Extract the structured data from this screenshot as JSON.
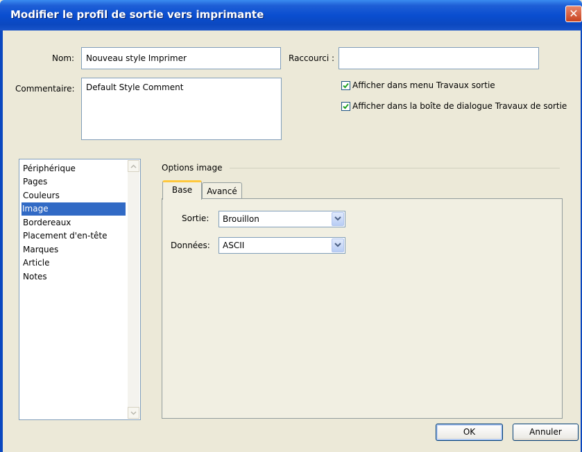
{
  "window": {
    "title": "Modifier le profil de sortie vers imprimante",
    "close_symbol": "✕"
  },
  "form": {
    "nom_label": "Nom:",
    "nom_value": "Nouveau style Imprimer",
    "raccourci_label": "Raccourci :",
    "raccourci_value": "",
    "commentaire_label": "Commentaire:",
    "commentaire_value": "Default Style Comment",
    "check_menu_label": "Afficher dans menu Travaux sortie",
    "check_menu_checked": true,
    "check_dialog_label": "Afficher dans la boîte de dialogue Travaux de sortie",
    "check_dialog_checked": true
  },
  "categories": {
    "items": [
      "Périphérique",
      "Pages",
      "Couleurs",
      "Image",
      "Bordereaux",
      "Placement d'en-tête",
      "Marques",
      "Article",
      "Notes"
    ],
    "selected": "Image"
  },
  "options": {
    "group_title": "Options image",
    "tabs": [
      "Base",
      "Avancé"
    ],
    "active_tab": "Base",
    "sortie_label": "Sortie:",
    "sortie_value": "Brouillon",
    "donnees_label": "Données:",
    "donnees_value": "ASCII"
  },
  "buttons": {
    "ok": "OK",
    "cancel": "Annuler"
  },
  "colors": {
    "titlebar": "#0a4ed0",
    "dialog_bg": "#ece9d8",
    "selection": "#316ac5",
    "checkmark": "#21a121"
  }
}
